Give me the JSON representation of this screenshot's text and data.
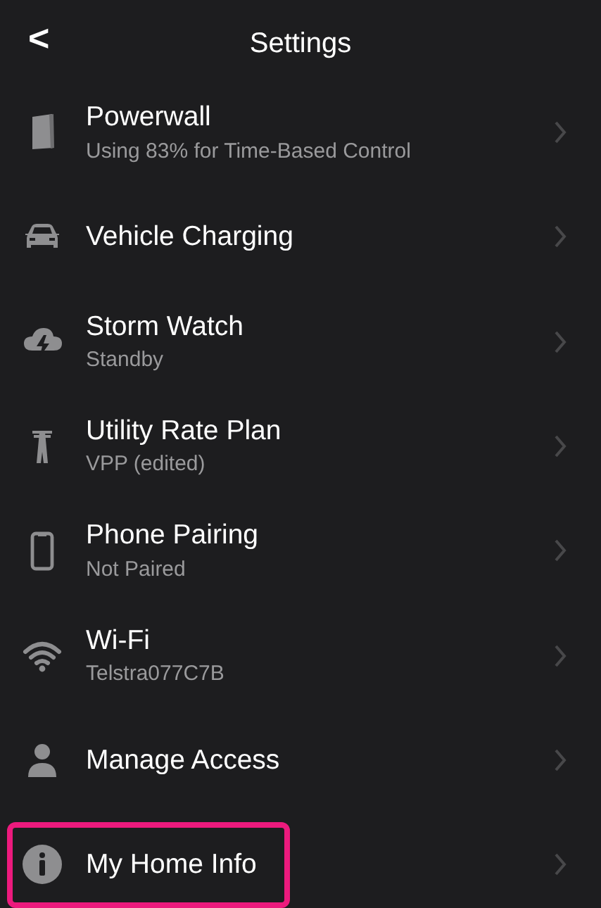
{
  "header": {
    "back": "<",
    "title": "Settings"
  },
  "items": [
    {
      "title": "Powerwall",
      "subtitle": "Using 83% for Time-Based Control",
      "highlighted": false
    },
    {
      "title": "Vehicle Charging",
      "highlighted": false
    },
    {
      "title": "Storm Watch",
      "subtitle": "Standby",
      "highlighted": false
    },
    {
      "title": "Utility Rate Plan",
      "subtitle": "VPP (edited)",
      "highlighted": false
    },
    {
      "title": "Phone Pairing",
      "subtitle": "Not Paired",
      "highlighted": false
    },
    {
      "title": "Wi-Fi",
      "subtitle": "Telstra077C7B",
      "highlighted": false
    },
    {
      "title": "Manage Access",
      "highlighted": false
    },
    {
      "title": "My Home Info",
      "highlighted": true
    }
  ]
}
